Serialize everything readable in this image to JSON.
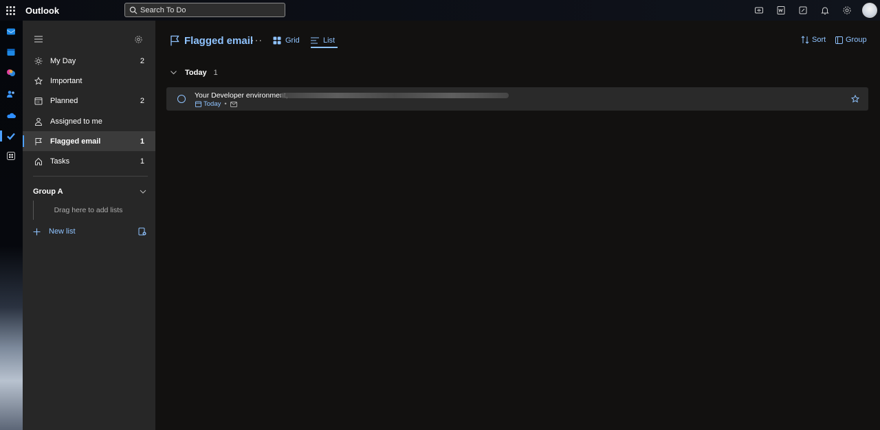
{
  "app": {
    "title": "Outlook",
    "search_placeholder": "Search To Do"
  },
  "topbar": {
    "icons": [
      "meet-now-icon",
      "word-icon",
      "notes-icon",
      "bell-icon",
      "gear-icon",
      "avatar"
    ]
  },
  "rail": {
    "icons": [
      "mail-icon",
      "calendar-icon",
      "copilot-icon",
      "people-icon",
      "onedrive-icon",
      "todo-icon",
      "apps-icon"
    ]
  },
  "sidebar": {
    "items": [
      {
        "label": "My Day",
        "count": "2",
        "icon": "sun-icon"
      },
      {
        "label": "Important",
        "count": "",
        "icon": "star-icon"
      },
      {
        "label": "Planned",
        "count": "2",
        "icon": "calendar-icon"
      },
      {
        "label": "Assigned to me",
        "count": "",
        "icon": "person-icon"
      },
      {
        "label": "Flagged email",
        "count": "1",
        "icon": "flag-icon"
      },
      {
        "label": "Tasks",
        "count": "1",
        "icon": "home-icon"
      }
    ],
    "group": {
      "name": "Group A",
      "drop_hint": "Drag here to add lists"
    },
    "new_list_label": "New list"
  },
  "main": {
    "title": "Flagged email",
    "more": "···",
    "views": {
      "grid": "Grid",
      "list": "List"
    },
    "sort_label": "Sort",
    "group_label": "Group",
    "section": {
      "title": "Today",
      "count": "1"
    },
    "tasks": [
      {
        "title": "Your Developer environment,",
        "due": "Today",
        "dot": "•"
      }
    ]
  },
  "colors": {
    "accent": "#8fc3ff",
    "sidebar_bg": "#272727",
    "main_bg": "#121110",
    "row_bg": "#2a2a2a"
  }
}
